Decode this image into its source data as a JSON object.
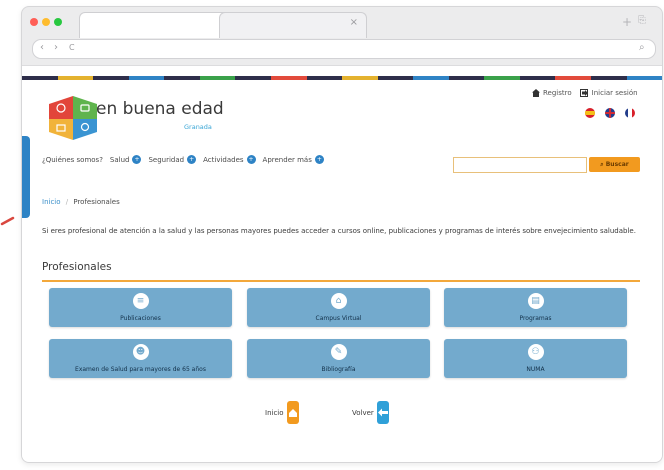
{
  "browser": {
    "tab_close_glyph": "×",
    "new_tab_glyph": "+",
    "nav_back": "‹",
    "nav_forward": "›",
    "nav_reload": "C",
    "address_search_glyph": "⌕"
  },
  "header": {
    "brand": "en buena edad",
    "brand_sub": "Granada",
    "register": "Registro",
    "login": "Iniciar sesión"
  },
  "menu": {
    "items": [
      {
        "label": "¿Quiénes somos?"
      },
      {
        "label": "Salud"
      },
      {
        "label": "Seguridad"
      },
      {
        "label": "Actividades"
      },
      {
        "label": "Aprender más"
      }
    ],
    "bullet": "+"
  },
  "search": {
    "button": "Buscar",
    "value": ""
  },
  "breadcrumb": {
    "home": "Inicio",
    "current": "Profesionales",
    "sep": "/"
  },
  "intro": "Si eres profesional de atención a la salud y las personas mayores puedes acceder a cursos online, publicaciones y programas de interés sobre envejecimiento saludable.",
  "section_title": "Profesionales",
  "tiles": [
    {
      "label": "Publicaciones",
      "icon": "book-icon",
      "glyph": "≡"
    },
    {
      "label": "Campus Virtual",
      "icon": "campus-icon",
      "glyph": "⌂"
    },
    {
      "label": "Programas",
      "icon": "document-icon",
      "glyph": "▤"
    },
    {
      "label": "Examen de Salud para mayores de 65 años",
      "icon": "head-profile-icon",
      "glyph": "☻"
    },
    {
      "label": "Bibliografía",
      "icon": "books-icon",
      "glyph": "✎"
    },
    {
      "label": "NUMA",
      "icon": "group-icon",
      "glyph": "⚇"
    }
  ],
  "bottom_nav": {
    "home": "Inicio",
    "back": "Volver"
  },
  "colors": {
    "accent_blue": "#2e83c5",
    "tile_blue": "#73aacd",
    "accent_orange": "#f29a1f"
  }
}
